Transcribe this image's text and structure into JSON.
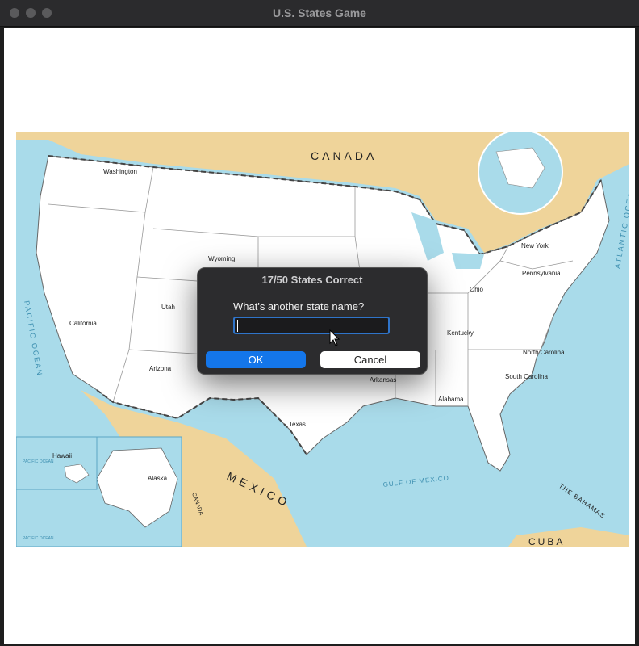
{
  "window": {
    "title": "U.S. States Game"
  },
  "map": {
    "country_labels": {
      "canada": "CANADA",
      "mexico": "MEXICO",
      "cuba": "CUBA",
      "bahamas": "THE BAHAMAS",
      "canada_small": "CANADA"
    },
    "ocean_labels": {
      "pacific": "PACIFIC OCEAN",
      "atlantic": "ATLANTIC OCEAN",
      "gulf": "GULF OF MEXICO",
      "pacific_small1": "PACIFIC OCEAN",
      "pacific_small2": "PACIFIC OCEAN"
    },
    "guessed_states": [
      "Washington",
      "Wyoming",
      "Utah",
      "California",
      "Arizona",
      "Texas",
      "Arkansas",
      "Ohio",
      "Kentucky",
      "New York",
      "Pennsylvania",
      "North Carolina",
      "South Carolina",
      "Alabama",
      "Hawaii",
      "Alaska"
    ],
    "colors": {
      "water": "#a9dbea",
      "land_foreign": "#efd49a",
      "land_us": "#ffffff",
      "border": "#888888"
    }
  },
  "dialog": {
    "title": "17/50 States Correct",
    "prompt": "What's another state name?",
    "input_value": "",
    "ok_label": "OK",
    "cancel_label": "Cancel"
  }
}
